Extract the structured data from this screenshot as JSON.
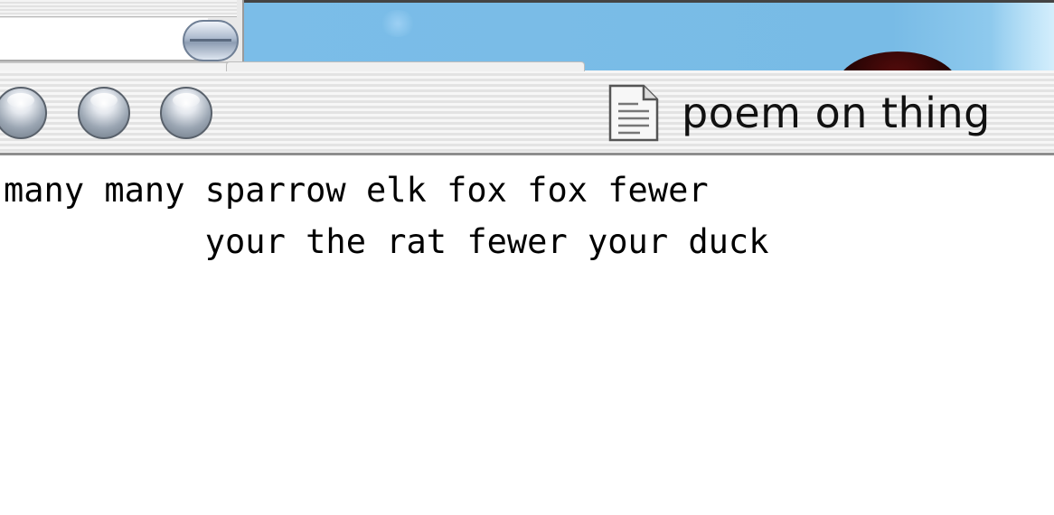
{
  "window": {
    "title": "poem on thing",
    "title_icon": "text-document-icon",
    "controls": [
      "close-button",
      "minimize-button",
      "zoom-button"
    ]
  },
  "document": {
    "lines": [
      "many many sparrow elk fox fox fewer",
      "          your the rat fewer your duck"
    ]
  },
  "colors": {
    "desktop_blue": "#7bbde8",
    "titlebar_light": "#f6f6f6",
    "titlebar_dark": "#e3e3e3",
    "text": "#000000"
  }
}
